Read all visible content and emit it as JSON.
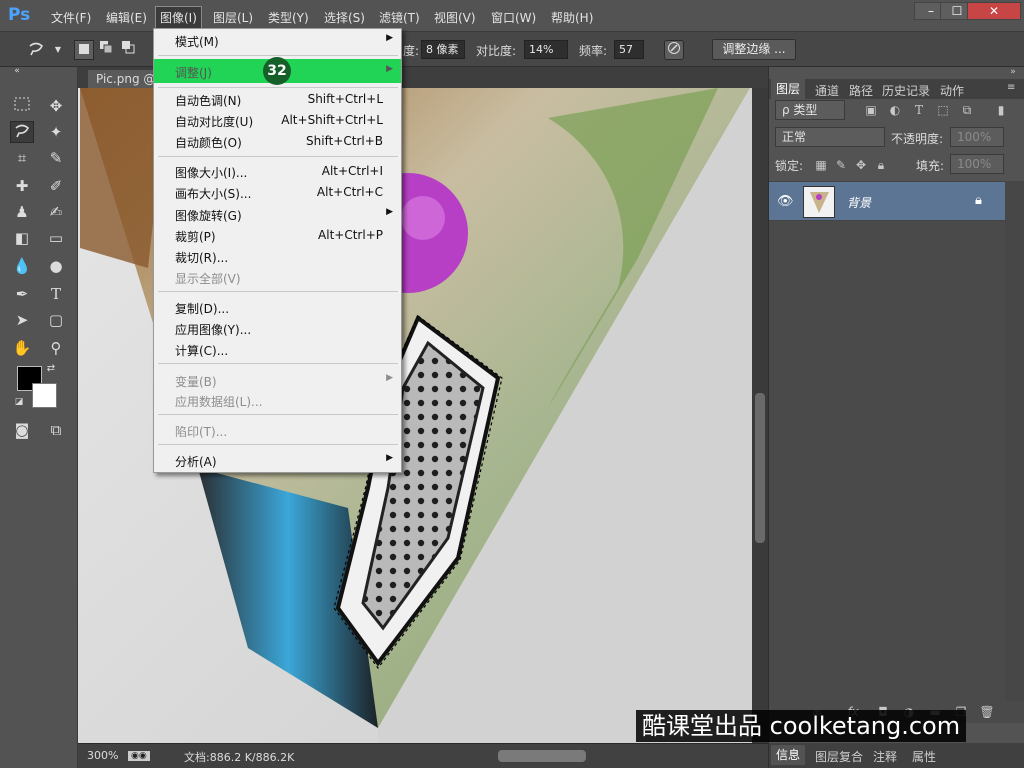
{
  "app": {
    "logo": "Ps"
  },
  "menubar": {
    "items": [
      "文件(F)",
      "编辑(E)",
      "图像(I)",
      "图层(L)",
      "类型(Y)",
      "选择(S)",
      "滤镜(T)",
      "视图(V)",
      "窗口(W)",
      "帮助(H)"
    ],
    "window_buttons": [
      "–",
      "☐",
      "✕"
    ]
  },
  "options": {
    "feather_label": "度:",
    "width_value": "8 像素",
    "contrast_label": "对比度:",
    "contrast_value": "14%",
    "frequency_label": "频率:",
    "frequency_value": "57",
    "refine_edge_button": "调整边缘 ..."
  },
  "document": {
    "tab_label": "Pic.png @ 3"
  },
  "status": {
    "zoom": "300%",
    "doc_info": "文档:886.2 K/886.2K"
  },
  "image_menu": {
    "items": [
      {
        "label": "模式(M)",
        "shortcut": "",
        "submenu": true,
        "disabled": false
      },
      {
        "label": "调整(J)",
        "shortcut": "",
        "submenu": true,
        "disabled": false
      },
      {
        "label": "自动色调(N)",
        "shortcut": "Shift+Ctrl+L",
        "submenu": false,
        "disabled": false
      },
      {
        "label": "自动对比度(U)",
        "shortcut": "Alt+Shift+Ctrl+L",
        "submenu": false,
        "disabled": false
      },
      {
        "label": "自动颜色(O)",
        "shortcut": "Shift+Ctrl+B",
        "submenu": false,
        "disabled": false
      },
      {
        "label": "图像大小(I)...",
        "shortcut": "Alt+Ctrl+I",
        "submenu": false,
        "disabled": false
      },
      {
        "label": "画布大小(S)...",
        "shortcut": "Alt+Ctrl+C",
        "submenu": false,
        "disabled": false
      },
      {
        "label": "图像旋转(G)",
        "shortcut": "",
        "submenu": true,
        "disabled": false
      },
      {
        "label": "裁剪(P)",
        "shortcut": "Alt+Ctrl+P",
        "submenu": false,
        "disabled": false
      },
      {
        "label": "裁切(R)...",
        "shortcut": "",
        "submenu": false,
        "disabled": false
      },
      {
        "label": "显示全部(V)",
        "shortcut": "",
        "submenu": false,
        "disabled": true
      },
      {
        "label": "复制(D)...",
        "shortcut": "",
        "submenu": false,
        "disabled": false
      },
      {
        "label": "应用图像(Y)...",
        "shortcut": "",
        "submenu": false,
        "disabled": false
      },
      {
        "label": "计算(C)...",
        "shortcut": "",
        "submenu": false,
        "disabled": false
      },
      {
        "label": "变量(B)",
        "shortcut": "",
        "submenu": true,
        "disabled": true
      },
      {
        "label": "应用数据组(L)...",
        "shortcut": "",
        "submenu": false,
        "disabled": true
      },
      {
        "label": "陷印(T)...",
        "shortcut": "",
        "submenu": false,
        "disabled": true
      },
      {
        "label": "分析(A)",
        "shortcut": "",
        "submenu": true,
        "disabled": false
      }
    ],
    "step_badge": "32"
  },
  "layers_panel": {
    "tabs": [
      "图层",
      "通道",
      "路径",
      "历史记录",
      "动作"
    ],
    "filter_kind": "ρ 类型",
    "blend_mode": "正常",
    "opacity_label": "不透明度:",
    "opacity_value": "100%",
    "lock_label": "锁定:",
    "fill_label": "填充:",
    "fill_value": "100%",
    "layer_name": "背景"
  },
  "bottom_tabs": [
    "信息",
    "图层复合",
    "注释",
    "属性"
  ],
  "watermark": "酷课堂出品 coolketang.com",
  "colors": {
    "menu_highlight": "#21d455",
    "badge": "#155f28",
    "layer_selected": "#5c7595"
  }
}
